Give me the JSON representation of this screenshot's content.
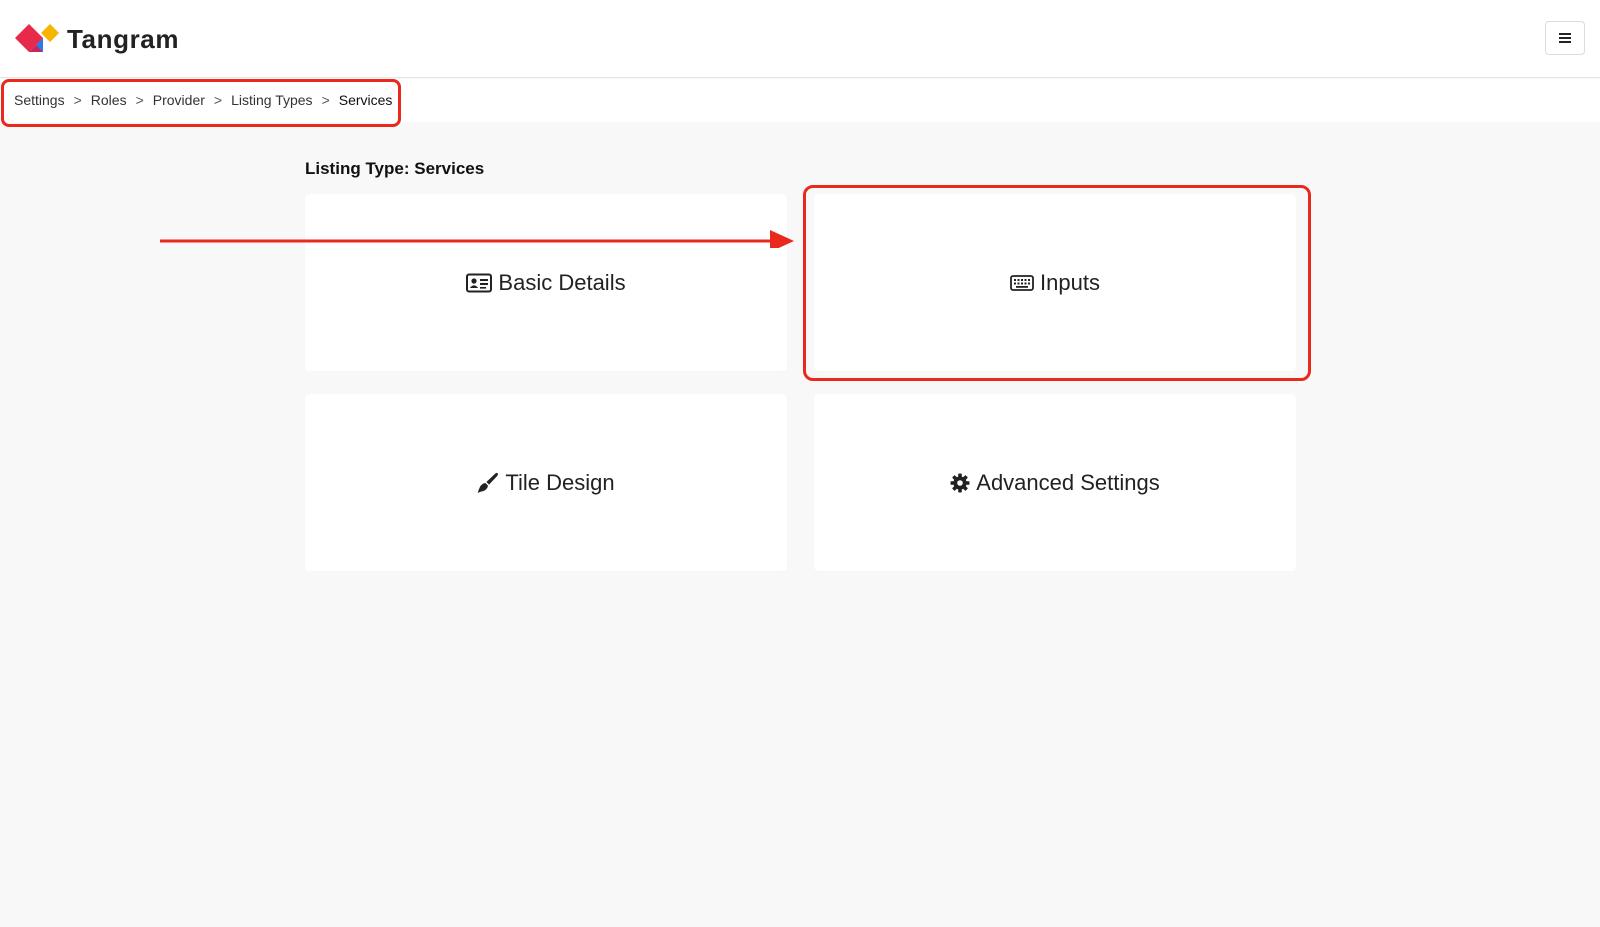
{
  "header": {
    "brand": "Tangram",
    "logo_icon": "tangram-logo",
    "menu_icon": "hamburger-icon",
    "colors": {
      "logo_red": "#e8294a",
      "logo_yellow": "#f7b500",
      "logo_blue": "#2f7be5",
      "logo_pink": "#c8245e"
    }
  },
  "breadcrumb": {
    "items": [
      {
        "label": "Settings"
      },
      {
        "label": "Roles"
      },
      {
        "label": "Provider"
      },
      {
        "label": "Listing Types"
      },
      {
        "label": "Services"
      }
    ],
    "separator": ">"
  },
  "page": {
    "section_title": "Listing Type: Services"
  },
  "cards": [
    {
      "label": "Basic Details",
      "icon": "id-card-icon"
    },
    {
      "label": "Inputs",
      "icon": "keyboard-icon"
    },
    {
      "label": "Tile Design",
      "icon": "paint-brush-icon"
    },
    {
      "label": "Advanced Settings",
      "icon": "gear-icon"
    }
  ],
  "annotations": {
    "highlight_color": "#e8291c"
  }
}
